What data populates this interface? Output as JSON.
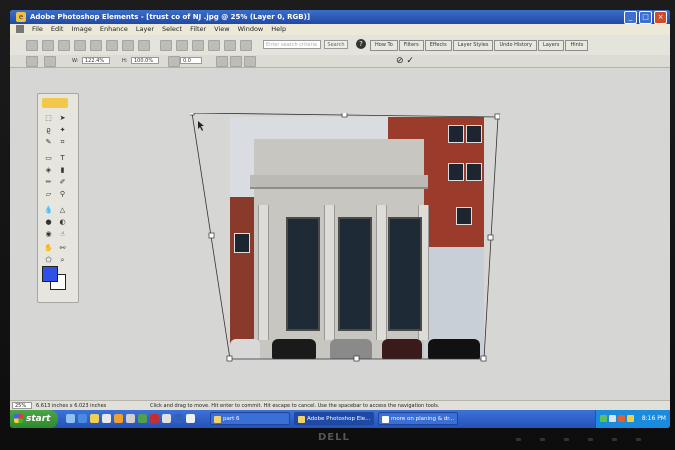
{
  "window": {
    "title": "Adobe Photoshop Elements - [trust co of NJ .jpg @ 25% (Layer 0, RGB)]",
    "controls": [
      "_",
      "□",
      "×"
    ]
  },
  "menubar": {
    "items": [
      "File",
      "Edit",
      "Image",
      "Enhance",
      "Layer",
      "Select",
      "Filter",
      "View",
      "Window",
      "Help"
    ]
  },
  "toolbar": {
    "search_placeholder": "Enter search criteria",
    "search_button": "Search",
    "help_glyph": "?",
    "palette_tabs": [
      "How To",
      "Filters",
      "Effects",
      "Layer Styles",
      "Undo History",
      "Layers",
      "Hints"
    ]
  },
  "options": {
    "w_label": "W:",
    "w_value": "122.4%",
    "h_label": "H:",
    "h_value": "100.0%",
    "angle_value": "0.0",
    "cancel_glyph": "⊘",
    "commit_glyph": "✓"
  },
  "statusbar": {
    "zoom": "25%",
    "doc_size": "6.613 inches x 6.023 inches",
    "hint": "Click and drag to move. Hit enter to commit. Hit escape to cancel. Use the spacebar to access the navigation tools."
  },
  "taskbar": {
    "start_label": "start",
    "tasks": [
      {
        "label": "part 6",
        "active": false
      },
      {
        "label": "Adobe Photoshop Ele...",
        "active": true
      },
      {
        "label": "more on planing & dr...",
        "active": false
      }
    ],
    "clock": "8:16 PM"
  },
  "bezel": {
    "brand": "DELL"
  },
  "colors": {
    "foreground": "#2f4fe8",
    "background": "#ffffff",
    "taskbar": "#2551b8",
    "titlebar": "#1f4aa6"
  }
}
